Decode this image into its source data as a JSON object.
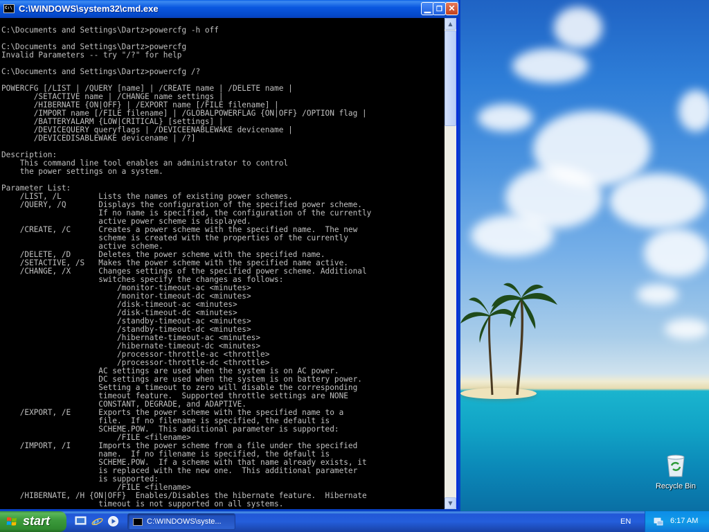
{
  "window": {
    "title": "C:\\WINDOWS\\system32\\cmd.exe",
    "icon": "cmd-icon",
    "buttons": [
      "minimize",
      "restore",
      "close"
    ]
  },
  "console": {
    "lines": [
      "",
      "C:\\Documents and Settings\\Dartz>powercfg -h off",
      "",
      "C:\\Documents and Settings\\Dartz>powercfg",
      "Invalid Parameters -- try \"/?\" for help",
      "",
      "C:\\Documents and Settings\\Dartz>powercfg /?",
      "",
      "POWERCFG [/LIST | /QUERY [name] | /CREATE name | /DELETE name |",
      "       /SETACTIVE name | /CHANGE name settings |",
      "       /HIBERNATE {ON|OFF} | /EXPORT name [/FILE filename] |",
      "       /IMPORT name [/FILE filename] | /GLOBALPOWERFLAG {ON|OFF} /OPTION flag |",
      "       /BATTERYALARM {LOW|CRITICAL} [settings] |",
      "       /DEVICEQUERY queryflags | /DEVICEENABLEWAKE devicename |",
      "       /DEVICEDISABLEWAKE devicename | /?]",
      "",
      "Description:",
      "    This command line tool enables an administrator to control",
      "    the power settings on a system.",
      "",
      "Parameter List:",
      "    /LIST, /L        Lists the names of existing power schemes.",
      "    /QUERY, /Q       Displays the configuration of the specified power scheme.",
      "                     If no name is specified, the configuration of the currently",
      "                     active power scheme is displayed.",
      "    /CREATE, /C      Creates a power scheme with the specified name.  The new",
      "                     scheme is created with the properties of the currently",
      "                     active scheme.",
      "    /DELETE, /D      Deletes the power scheme with the specified name.",
      "    /SETACTIVE, /S   Makes the power scheme with the specified name active.",
      "    /CHANGE, /X      Changes settings of the specified power scheme. Additional",
      "                     switches specify the changes as follows:",
      "                         /monitor-timeout-ac <minutes>",
      "                         /monitor-timeout-dc <minutes>",
      "                         /disk-timeout-ac <minutes>",
      "                         /disk-timeout-dc <minutes>",
      "                         /standby-timeout-ac <minutes>",
      "                         /standby-timeout-dc <minutes>",
      "                         /hibernate-timeout-ac <minutes>",
      "                         /hibernate-timeout-dc <minutes>",
      "                         /processor-throttle-ac <throttle>",
      "                         /processor-throttle-dc <throttle>",
      "                     AC settings are used when the system is on AC power.",
      "                     DC settings are used when the system is on battery power.",
      "                     Setting a timeout to zero will disable the corresponding",
      "                     timeout feature.  Supported throttle settings are NONE",
      "                     CONSTANT, DEGRADE, and ADAPTIVE.",
      "    /EXPORT, /E      Exports the power scheme with the specified name to a",
      "                     file.  If no filename is specified, the default is",
      "                     SCHEME.POW.  This additional parameter is supported:",
      "                         /FILE <filename>",
      "    /IMPORT, /I      Imports the power scheme from a file under the specified",
      "                     name.  If no filename is specified, the default is",
      "                     SCHEME.POW.  If a scheme with that name already exists, it",
      "                     is replaced with the new one.  This additional parameter",
      "                     is supported:",
      "                         /FILE <filename>",
      "    /HIBERNATE, /H {ON|OFF}  Enables/Disables the hibernate feature.  Hibernate",
      "                     timeout is not supported on all systems."
    ]
  },
  "desktop": {
    "recycle_bin_label": "Recycle Bin"
  },
  "taskbar": {
    "start_label": "start",
    "task_title": "C:\\WINDOWS\\syste...",
    "language": "EN",
    "clock": "6:17 AM"
  }
}
